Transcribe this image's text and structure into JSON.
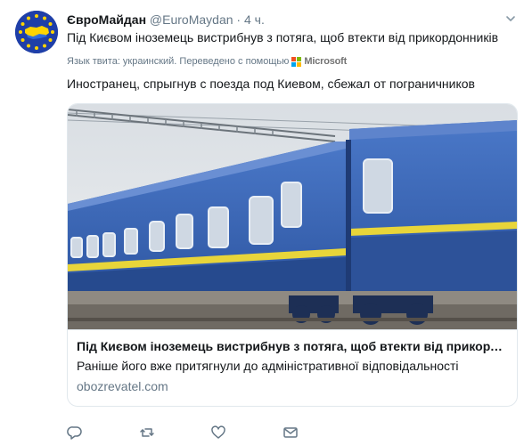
{
  "tweet": {
    "author_name": "ЄвроМайдан",
    "author_handle": "@EuroMaydan",
    "separator": "·",
    "time": "4 ч.",
    "text": "Під Києвом іноземець вистрибнув з потяга, щоб втекти від прикордонників",
    "translation_meta": "Язык твита: украинский. Переведено с помощью",
    "translation_provider": "Microsoft",
    "translated_text": "Иностранец, спрыгнув с поезда под Киевом, сбежал от пограничников"
  },
  "card": {
    "title": "Під Києвом іноземець вистрибнув з потяга, щоб втекти від прикордонників",
    "description": "Раніше його вже притягнули до адміністративної відповідальності",
    "domain": "obozrevatel.com"
  },
  "icons": {
    "menu": "chevron-down-icon",
    "reply": "reply-icon",
    "retweet": "retweet-icon",
    "like": "heart-icon",
    "message": "envelope-icon"
  },
  "colors": {
    "text": "#14171a",
    "secondary": "#657786",
    "border": "#e1e8ed",
    "avatar_blue": "#1f3fa8",
    "avatar_yellow": "#ffd400",
    "train_blue": "#3a66b8"
  }
}
